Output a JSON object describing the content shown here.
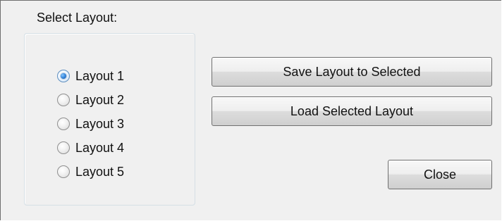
{
  "dialog": {
    "group_title": "Select Layout:",
    "radio_items": [
      {
        "label": "Layout 1",
        "checked": true
      },
      {
        "label": "Layout 2",
        "checked": false
      },
      {
        "label": "Layout 3",
        "checked": false
      },
      {
        "label": "Layout 4",
        "checked": false
      },
      {
        "label": "Layout 5",
        "checked": false
      }
    ],
    "buttons": {
      "save": "Save Layout to Selected",
      "load": "Load Selected Layout",
      "close": "Close"
    }
  },
  "colors": {
    "dialog_background": "#f0f0f0",
    "border": "#707070",
    "selected_radio": "#2f7fd6"
  }
}
